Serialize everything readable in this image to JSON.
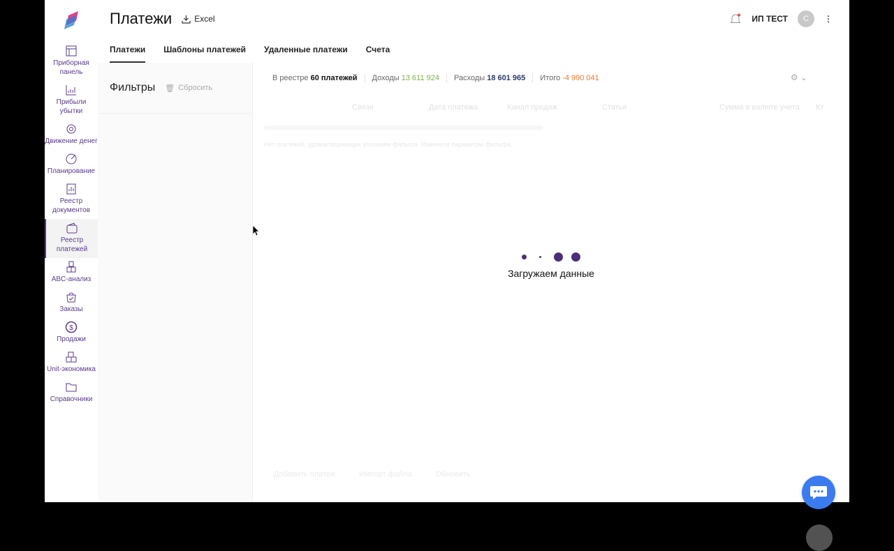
{
  "sidebar": {
    "items": [
      {
        "label": "Приборная панель",
        "icon": "dashboard-icon"
      },
      {
        "label": "Прибыли убытки",
        "icon": "chart-icon"
      },
      {
        "label": "Движение денег",
        "icon": "money-flow-icon"
      },
      {
        "label": "Планирование",
        "icon": "target-icon"
      },
      {
        "label": "Реестр документов",
        "icon": "documents-icon"
      },
      {
        "label": "Реестр платежей",
        "icon": "wallet-icon",
        "active": true
      },
      {
        "label": "ABC-анализ",
        "icon": "abc-icon"
      },
      {
        "label": "Заказы",
        "icon": "bag-icon"
      },
      {
        "label": "Продажи",
        "icon": "dollar-icon"
      },
      {
        "label": "Unit-экономика",
        "icon": "boxes-icon"
      },
      {
        "label": "Справочники",
        "icon": "folder-icon"
      }
    ]
  },
  "header": {
    "title": "Платежи",
    "excel": "Excel",
    "user": "ИП ТЕСТ",
    "avatar": "С"
  },
  "tabs": [
    "Платежи",
    "Шаблоны платежей",
    "Удаленные платежи",
    "Счета"
  ],
  "filters": {
    "title": "Фильтры",
    "reset": "Сбросить"
  },
  "summary": {
    "registry_label": "В реестре",
    "registry_value": "60 платежей",
    "income_label": "Доходы",
    "income_value": "13 611 924",
    "expense_label": "Расходы",
    "expense_value": "18 601 965",
    "total_label": "Итого",
    "total_value": "-4 990 041"
  },
  "colors": {
    "income": "#7cb342",
    "expense": "#2b3a67",
    "total": "#e8772e",
    "accent": "#4b2f7a"
  },
  "table": {
    "columns": [
      "Связи",
      "Дата платежа",
      "Канал продаж",
      "Статья",
      "Сумма в валюте учета",
      "Кт"
    ],
    "empty": "Нет платежей, удовлетворяющих условиям фильтра. Измените параметры фильтра."
  },
  "loading": "Загружаем данные",
  "bottom": {
    "add": "Добавить платеж",
    "import": "Импорт файла",
    "refresh": "Обновить"
  }
}
